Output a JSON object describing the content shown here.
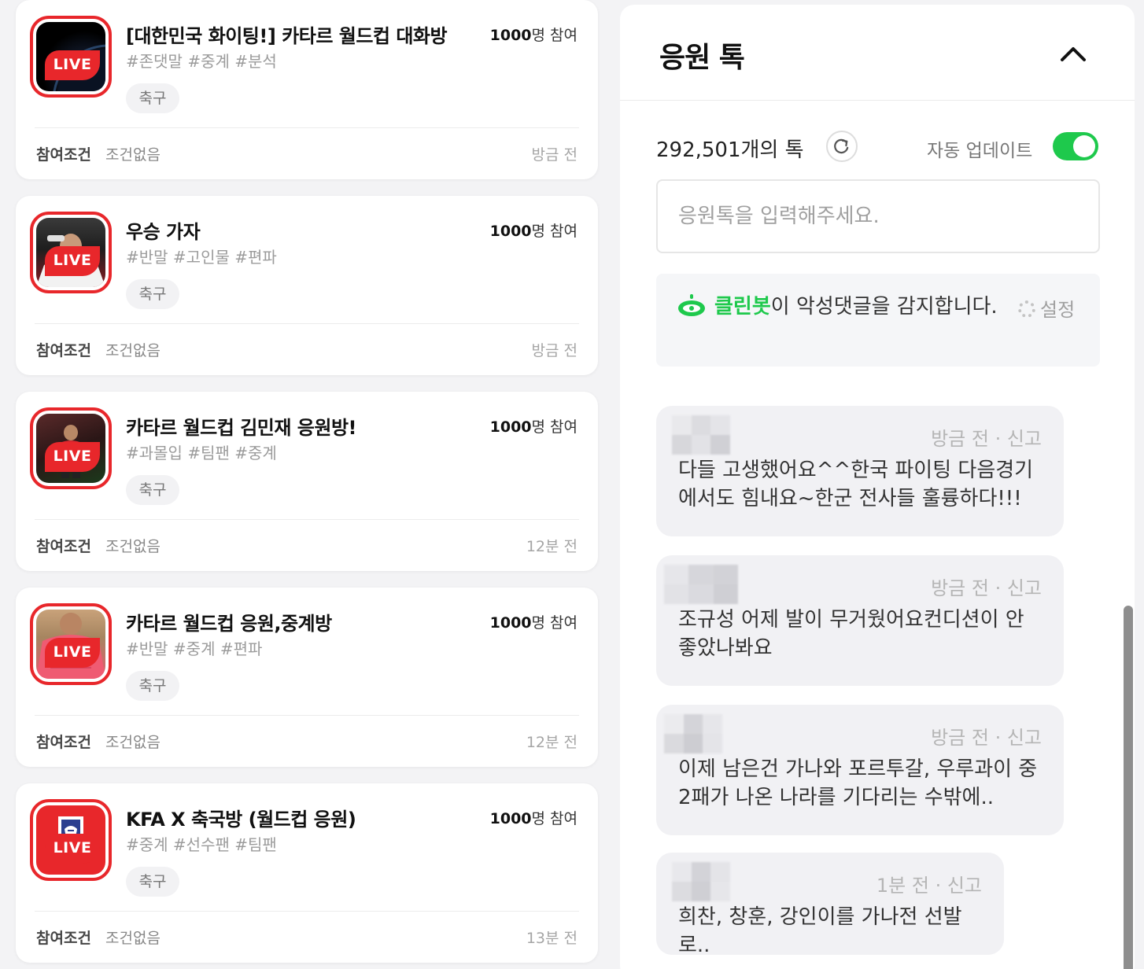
{
  "rooms": [
    {
      "title": "[대한민국 화이팅!] 카타르 월드컵 대화방",
      "participants_num": "1000",
      "participants_suffix": "명 참여",
      "tags": "#존댓말 #중계 #분석",
      "category": "축구",
      "live": "LIVE",
      "condition_label": "참여조건",
      "condition_value": "조건없음",
      "time": "방금 전",
      "thumb_style": "planet"
    },
    {
      "title": "우승 가자",
      "participants_num": "1000",
      "participants_suffix": "명 참여",
      "tags": "#반말 #고인물 #편파",
      "category": "축구",
      "live": "LIVE",
      "condition_label": "참여조건",
      "condition_value": "조건없음",
      "time": "방금 전",
      "thumb_style": "player-white"
    },
    {
      "title": "카타르 월드컵 김민재 응원방!",
      "participants_num": "1000",
      "participants_suffix": "명 참여",
      "tags": "#과몰입 #팀팬 #중계",
      "category": "축구",
      "live": "LIVE",
      "condition_label": "참여조건",
      "condition_value": "조건없음",
      "time": "12분 전",
      "thumb_style": "player-red-dark"
    },
    {
      "title": "카타르 월드컵 응원,중계방",
      "participants_num": "1000",
      "participants_suffix": "명 참여",
      "tags": "#반말 #중계 #편파",
      "category": "축구",
      "live": "LIVE",
      "condition_label": "참여조건",
      "condition_value": "조건없음",
      "time": "12분 전",
      "thumb_style": "player-pink"
    },
    {
      "title": "KFA X 축국방 (월드컵 응원)",
      "participants_num": "1000",
      "participants_suffix": "명 참여",
      "tags": "#중계 #선수팬 #팀팬",
      "category": "축구",
      "live": "LIVE",
      "condition_label": "참여조건",
      "condition_value": "조건없음",
      "time": "13분 전",
      "thumb_style": "kfa-emblem"
    }
  ],
  "chat": {
    "title": "응원 톡",
    "collapse_icon": "chevron-up-icon",
    "talk_count": "292,501개의 톡",
    "refresh_icon": "refresh-icon",
    "auto_update_label": "자동 업데이트",
    "auto_update_on": true,
    "input_placeholder": "응원톡을 입력해주세요.",
    "cleanbot_brand": "클린봇",
    "cleanbot_text": "이 악성댓글을 감지합니다.",
    "settings_label": "설정",
    "accent": "#1ec94c",
    "messages": [
      {
        "meta": "방금 전 · 신고",
        "text": "다들 고생했어요^^한국 파이팅 다음경기에서도 힘내요~한군 전사들 훌륭하다!!!"
      },
      {
        "meta": "방금 전 · 신고",
        "text": "조규성 어제 발이 무거웠어요컨디션이 안좋았나봐요"
      },
      {
        "meta": "방금 전 · 신고",
        "text": "이제 남은건 가나와 포르투갈, 우루과이 중 2패가 나온 나라를 기다리는 수밖에.."
      },
      {
        "meta": "1분 전 · 신고",
        "text": "희찬, 창훈, 강인이를 가나전 선발로.."
      }
    ]
  },
  "colors": {
    "live_red": "#e8272b",
    "toggle_green": "#1ec94c"
  }
}
